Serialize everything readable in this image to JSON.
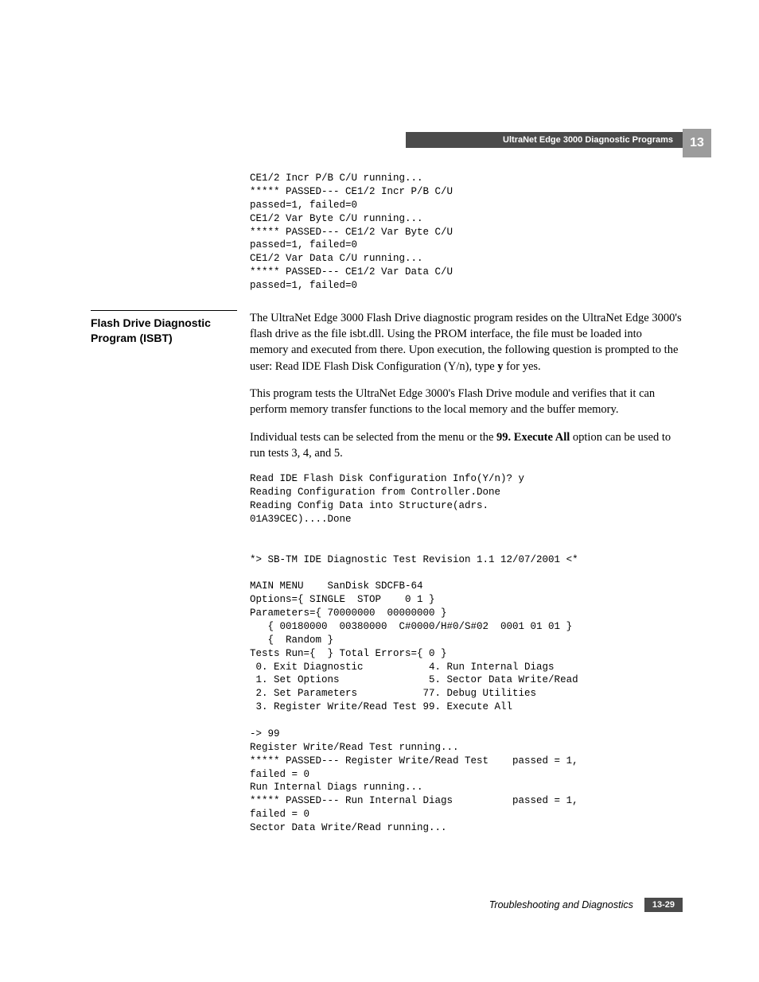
{
  "header": {
    "running_title": "UltraNet Edge 3000 Diagnostic Programs",
    "chapter_number": "13"
  },
  "code_block_top": "CE1/2 Incr P/B C/U running...\n***** PASSED--- CE1/2 Incr P/B C/U\npassed=1, failed=0\nCE1/2 Var Byte C/U running...\n***** PASSED--- CE1/2 Var Byte C/U\npassed=1, failed=0\nCE1/2 Var Data C/U running...\n***** PASSED--- CE1/2 Var Data C/U\npassed=1, failed=0",
  "section": {
    "side_heading": "Flash Drive Diagnostic Program (ISBT)",
    "para1_a": "The UltraNet Edge 3000 Flash Drive diagnostic program resides on the UltraNet Edge 3000's flash drive as the file isbt.dll. Using the PROM interface, the file must be loaded into memory and executed from there. Upon execution, the following question is prompted to the user: Read IDE Flash Disk Configuration (Y/n), type ",
    "para1_bold": "y",
    "para1_b": " for yes.",
    "para2": "This program tests the UltraNet Edge 3000's Flash Drive module and verifies that it can perform memory transfer functions to the local memory and the buffer memory.",
    "para3_a": "Individual tests can be selected from the menu or the ",
    "para3_bold": "99. Execute All",
    "para3_b": " option can be used to run tests 3, 4, and 5."
  },
  "code_block_bottom": "Read IDE Flash Disk Configuration Info(Y/n)? y\nReading Configuration from Controller.Done\nReading Config Data into Structure(adrs. \n01A39CEC)....Done\n\n\n*> SB-TM IDE Diagnostic Test Revision 1.1 12/07/2001 <*\n\nMAIN MENU    SanDisk SDCFB-64\nOptions={ SINGLE  STOP    0 1 }\nParameters={ 70000000  00000000 }\n   { 00180000  00380000  C#0000/H#0/S#02  0001 01 01 }\n   {  Random }\nTests Run={  } Total Errors={ 0 }\n 0. Exit Diagnostic           4. Run Internal Diags\n 1. Set Options               5. Sector Data Write/Read\n 2. Set Parameters           77. Debug Utilities\n 3. Register Write/Read Test 99. Execute All\n\n-> 99\nRegister Write/Read Test running...\n***** PASSED--- Register Write/Read Test    passed = 1, \nfailed = 0\nRun Internal Diags running...\n***** PASSED--- Run Internal Diags          passed = 1, \nfailed = 0\nSector Data Write/Read running...",
  "footer": {
    "title": "Troubleshooting and Diagnostics",
    "page": "13-29"
  }
}
